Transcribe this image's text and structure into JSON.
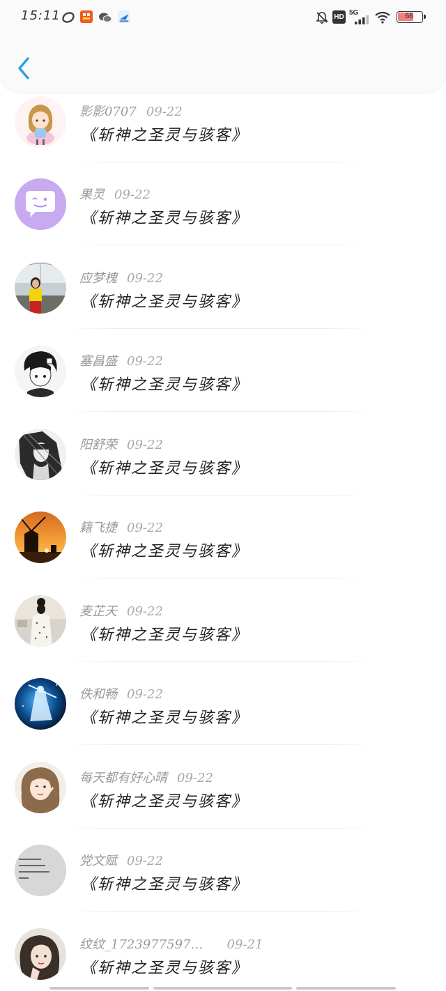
{
  "status_bar": {
    "time": "15:11",
    "network": "5G",
    "hd": "HD",
    "battery": "66"
  },
  "colors": {
    "accent": "#2aa0e8",
    "battery_fill": "#f08080"
  },
  "icons": [
    "back-arrow-icon",
    "bell-off-icon",
    "wifi-icon",
    "signal-icon",
    "battery-icon"
  ],
  "list": [
    {
      "name": "影影0707",
      "date": "09-22",
      "title": "《斩神之圣灵与骇客》"
    },
    {
      "name": "果灵",
      "date": "09-22",
      "title": "《斩神之圣灵与骇客》"
    },
    {
      "name": "应梦槐",
      "date": "09-22",
      "title": "《斩神之圣灵与骇客》"
    },
    {
      "name": "塞昌盛",
      "date": "09-22",
      "title": "《斩神之圣灵与骇客》"
    },
    {
      "name": "阳舒荣",
      "date": "09-22",
      "title": "《斩神之圣灵与骇客》"
    },
    {
      "name": "籍飞捷",
      "date": "09-22",
      "title": "《斩神之圣灵与骇客》"
    },
    {
      "name": "麦芷天",
      "date": "09-22",
      "title": "《斩神之圣灵与骇客》"
    },
    {
      "name": "佚和畅",
      "date": "09-22",
      "title": "《斩神之圣灵与骇客》"
    },
    {
      "name": "每天都有好心晴",
      "date": "09-22",
      "title": "《斩神之圣灵与骇客》"
    },
    {
      "name": "党文赋",
      "date": "09-22",
      "title": "《斩神之圣灵与骇客》"
    },
    {
      "name": "纹纹_1723977597…",
      "date": "09-21",
      "title": "《斩神之圣灵与骇客》"
    }
  ]
}
